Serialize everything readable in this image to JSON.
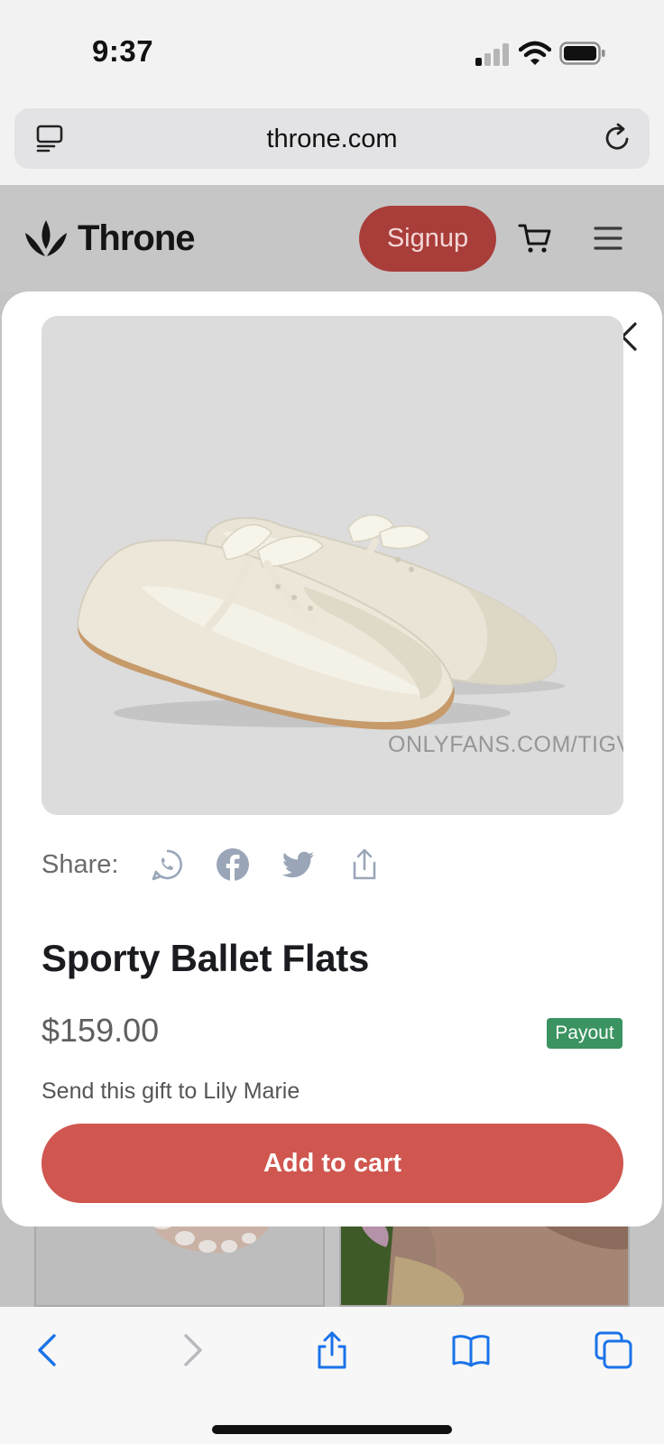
{
  "status_bar": {
    "time": "9:37"
  },
  "browser": {
    "url": "throne.com"
  },
  "site_header": {
    "brand": "Throne",
    "signup_label": "Signup"
  },
  "product_modal": {
    "watermark": "ONLYFANS.COM/TIGVIBES",
    "share_label": "Share:",
    "share_icons": [
      "whatsapp-icon",
      "facebook-icon",
      "twitter-icon",
      "share-upload-icon"
    ],
    "title": "Sporty Ballet Flats",
    "price": "$159.00",
    "badge": "Payout",
    "gift_text": "Send this gift to Lily Marie",
    "add_to_cart_label": "Add to cart"
  },
  "colors": {
    "brand_red": "#d05650",
    "signup_red_dimmed": "#a93d3a",
    "payout_green": "#3a9360",
    "ios_blue": "#1a73e8"
  },
  "toolbar": {
    "icons": [
      "back-icon",
      "forward-icon",
      "share-icon",
      "bookmarks-icon",
      "tabs-icon"
    ]
  }
}
